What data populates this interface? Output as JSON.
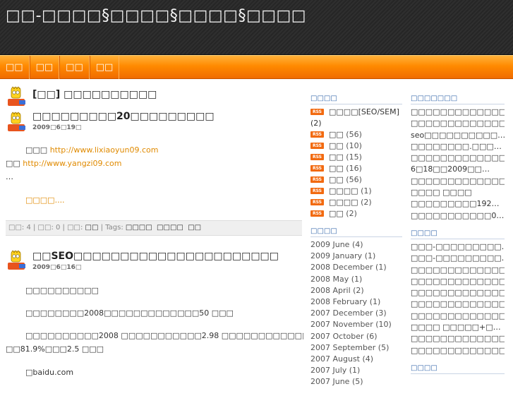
{
  "site": {
    "title": "□□-□□□□§□□□□§□□□□§□□□□"
  },
  "nav": [
    "□□",
    "□□",
    "□□",
    "□□"
  ],
  "posts": [
    {
      "title": "[□□] □□□□□□□□□□"
    },
    {
      "title": "□□□□□□□□□20□□□□□□□□□",
      "date": "2009□6□19□",
      "line1_prefix": "□□□",
      "line1_link": "http://www.lixiaoyun09.com",
      "line2_prefix": "□□",
      "line2_link": "http://www.yangzi09.com",
      "ellipsis": "…",
      "readmore": "□□□□....",
      "meta": {
        "comments_label": "□□: 4",
        "trackbacks_label": "□□: 0",
        "category_label": "□□:",
        "category_value": "□□",
        "tags_label": "Tags:",
        "tags": [
          "□□□□",
          "□□□□",
          "□□"
        ]
      }
    },
    {
      "title": "□□SEO□□□□□□□□□□□□□□□□□□□□□□",
      "date": "2009□6□16□",
      "paragraphs": [
        "□□□□□□□□□□",
        "□□□□□□□□2008□□□□□□□□□□□□□50 □□□",
        "□□□□□□□□□□2008 □□□□□□□□□□□2.98 □□□□□□□□□□□□□□□□□□□□□□□",
        "□□81.9%□□□2.5 □□□",
        "□baidu.com"
      ]
    }
  ],
  "sidebar_categories": {
    "heading": "□□□□",
    "items": [
      {
        "name": "□□□□[SEO/SEM]",
        "count": ""
      },
      {
        "name": "(2)",
        "count": ""
      },
      {
        "name": "□□",
        "count": "(56)"
      },
      {
        "name": "□□",
        "count": "(10)"
      },
      {
        "name": "□□",
        "count": "(15)"
      },
      {
        "name": "□□",
        "count": "(16)"
      },
      {
        "name": "□□",
        "count": "(56)"
      },
      {
        "name": "□□□□",
        "count": "(1)"
      },
      {
        "name": "□□□□",
        "count": "(2)"
      },
      {
        "name": "□□",
        "count": "(2)"
      }
    ],
    "rss_label": "RSS"
  },
  "sidebar_archives": {
    "heading": "□□□□",
    "items": [
      "2009 June (4)",
      "2009 January (1)",
      "2008 December (1)",
      "2008 May (1)",
      "2008 April (2)",
      "2008 February (1)",
      "2007 December (3)",
      "2007 November (10)",
      "2007 October (6)",
      "2007 September (5)",
      "2007 August (4)",
      "2007 July (1)",
      "2007 June (5)"
    ]
  },
  "sidebar_recent": {
    "heading": "□□□□□□□",
    "items": [
      "□□□□□□□□□□□□□□…",
      "□□□□□□□□□□□□□□…",
      "seo□□□□□□□□□□…",
      "□□□□□□□□.□□□…",
      "□□□□□□□□□□□□□□…",
      "6□18□□2009□□…",
      "□□□□□□□□□□□□□□…",
      "□□□□ □□□□",
      "□□□□□□□□□192…",
      "□□□□□□□□□□□0…"
    ]
  },
  "sidebar_links": {
    "heading": "□□□□",
    "items": [
      "□□□-□□□□□□□□□…",
      "□□□-□□□□□□□□□…",
      "□□□□□□□□□□□□□□…",
      "□□□□□□□□□□□□□□…",
      "□□□□□□□□□□□□□□…",
      "□□□□□□□□□□□□□□…",
      "□□□□□□□□□□□□□□…",
      "□□□□ □□□□□+□…",
      "□□□□□□□□□□□□□□…",
      "□□□□□□□□□□□□□□…"
    ]
  },
  "sidebar_bottom": {
    "heading": "□□□□"
  }
}
